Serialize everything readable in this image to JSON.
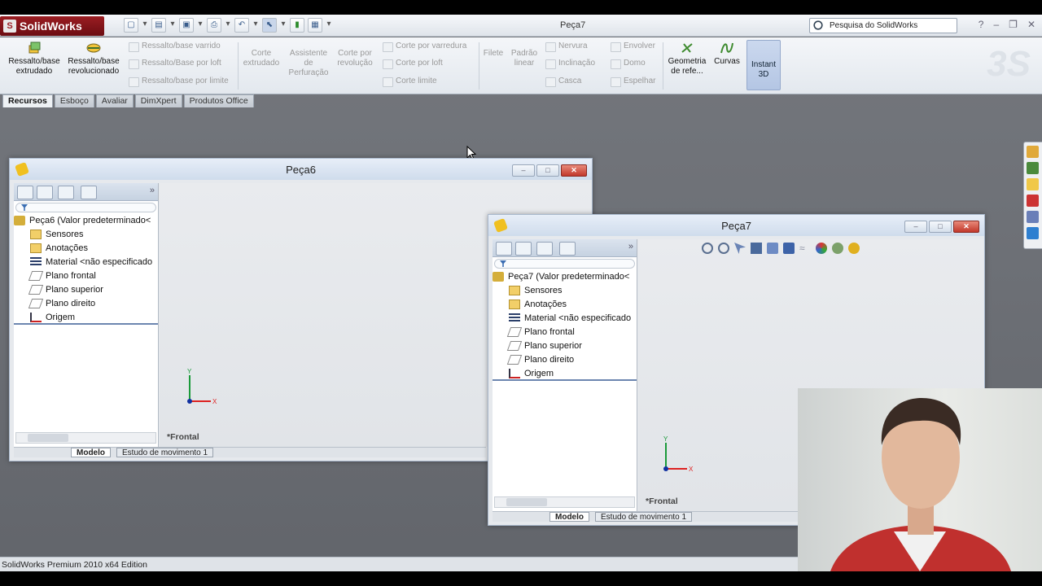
{
  "app": {
    "name": "SolidWorks",
    "title": "Peça7",
    "search_placeholder": "Pesquisa do SolidWorks",
    "status": "SolidWorks Premium 2010 x64 Edition",
    "help": "?"
  },
  "ribbon": {
    "extrude_boss": "Ressalto/base extrudado",
    "revolve_boss": "Ressalto/base revolucionado",
    "sweep_boss": "Ressalto/base varrido",
    "loft_boss": "Ressalto/Base por loft",
    "boundary_boss": "Ressalto/base por limite",
    "extruded_cut": "Corte extrudado",
    "hole_wizard": "Assistente de Perfuração",
    "revolved_cut": "Corte por revolução",
    "swept_cut": "Corte por varredura",
    "lofted_cut": "Corte por loft",
    "boundary_cut": "Corte limite",
    "fillet": "Filete",
    "linear_pattern": "Padrão linear",
    "rib": "Nervura",
    "draft": "Inclinação",
    "shell": "Casca",
    "wrap": "Envolver",
    "dome": "Domo",
    "mirror": "Espelhar",
    "reference_geometry": "Geometria de refe...",
    "curves": "Curvas",
    "instant3d": "Instant 3D"
  },
  "tabs": [
    "Recursos",
    "Esboço",
    "Avaliar",
    "DimXpert",
    "Produtos Office"
  ],
  "windows": [
    {
      "title": "Peça6",
      "tree_root": "Peça6  (Valor predeterminado<",
      "items": [
        "Sensores",
        "Anotações",
        "Material <não especificado",
        "Plano frontal",
        "Plano superior",
        "Plano direito",
        "Origem"
      ],
      "view_label": "*Frontal",
      "bottom_tabs": [
        "Modelo",
        "Estudo de movimento 1"
      ]
    },
    {
      "title": "Peça7",
      "tree_root": "Peça7  (Valor predeterminado<",
      "items": [
        "Sensores",
        "Anotações",
        "Material <não especificado",
        "Plano frontal",
        "Plano superior",
        "Plano direito",
        "Origem"
      ],
      "view_label": "*Frontal",
      "bottom_tabs": [
        "Modelo",
        "Estudo de movimento 1"
      ]
    }
  ],
  "axes": {
    "x": "X",
    "y": "Y"
  },
  "colors": {
    "brand": "#9b1d22",
    "close": "#c1372b",
    "highlight": "#b4c6e4"
  }
}
